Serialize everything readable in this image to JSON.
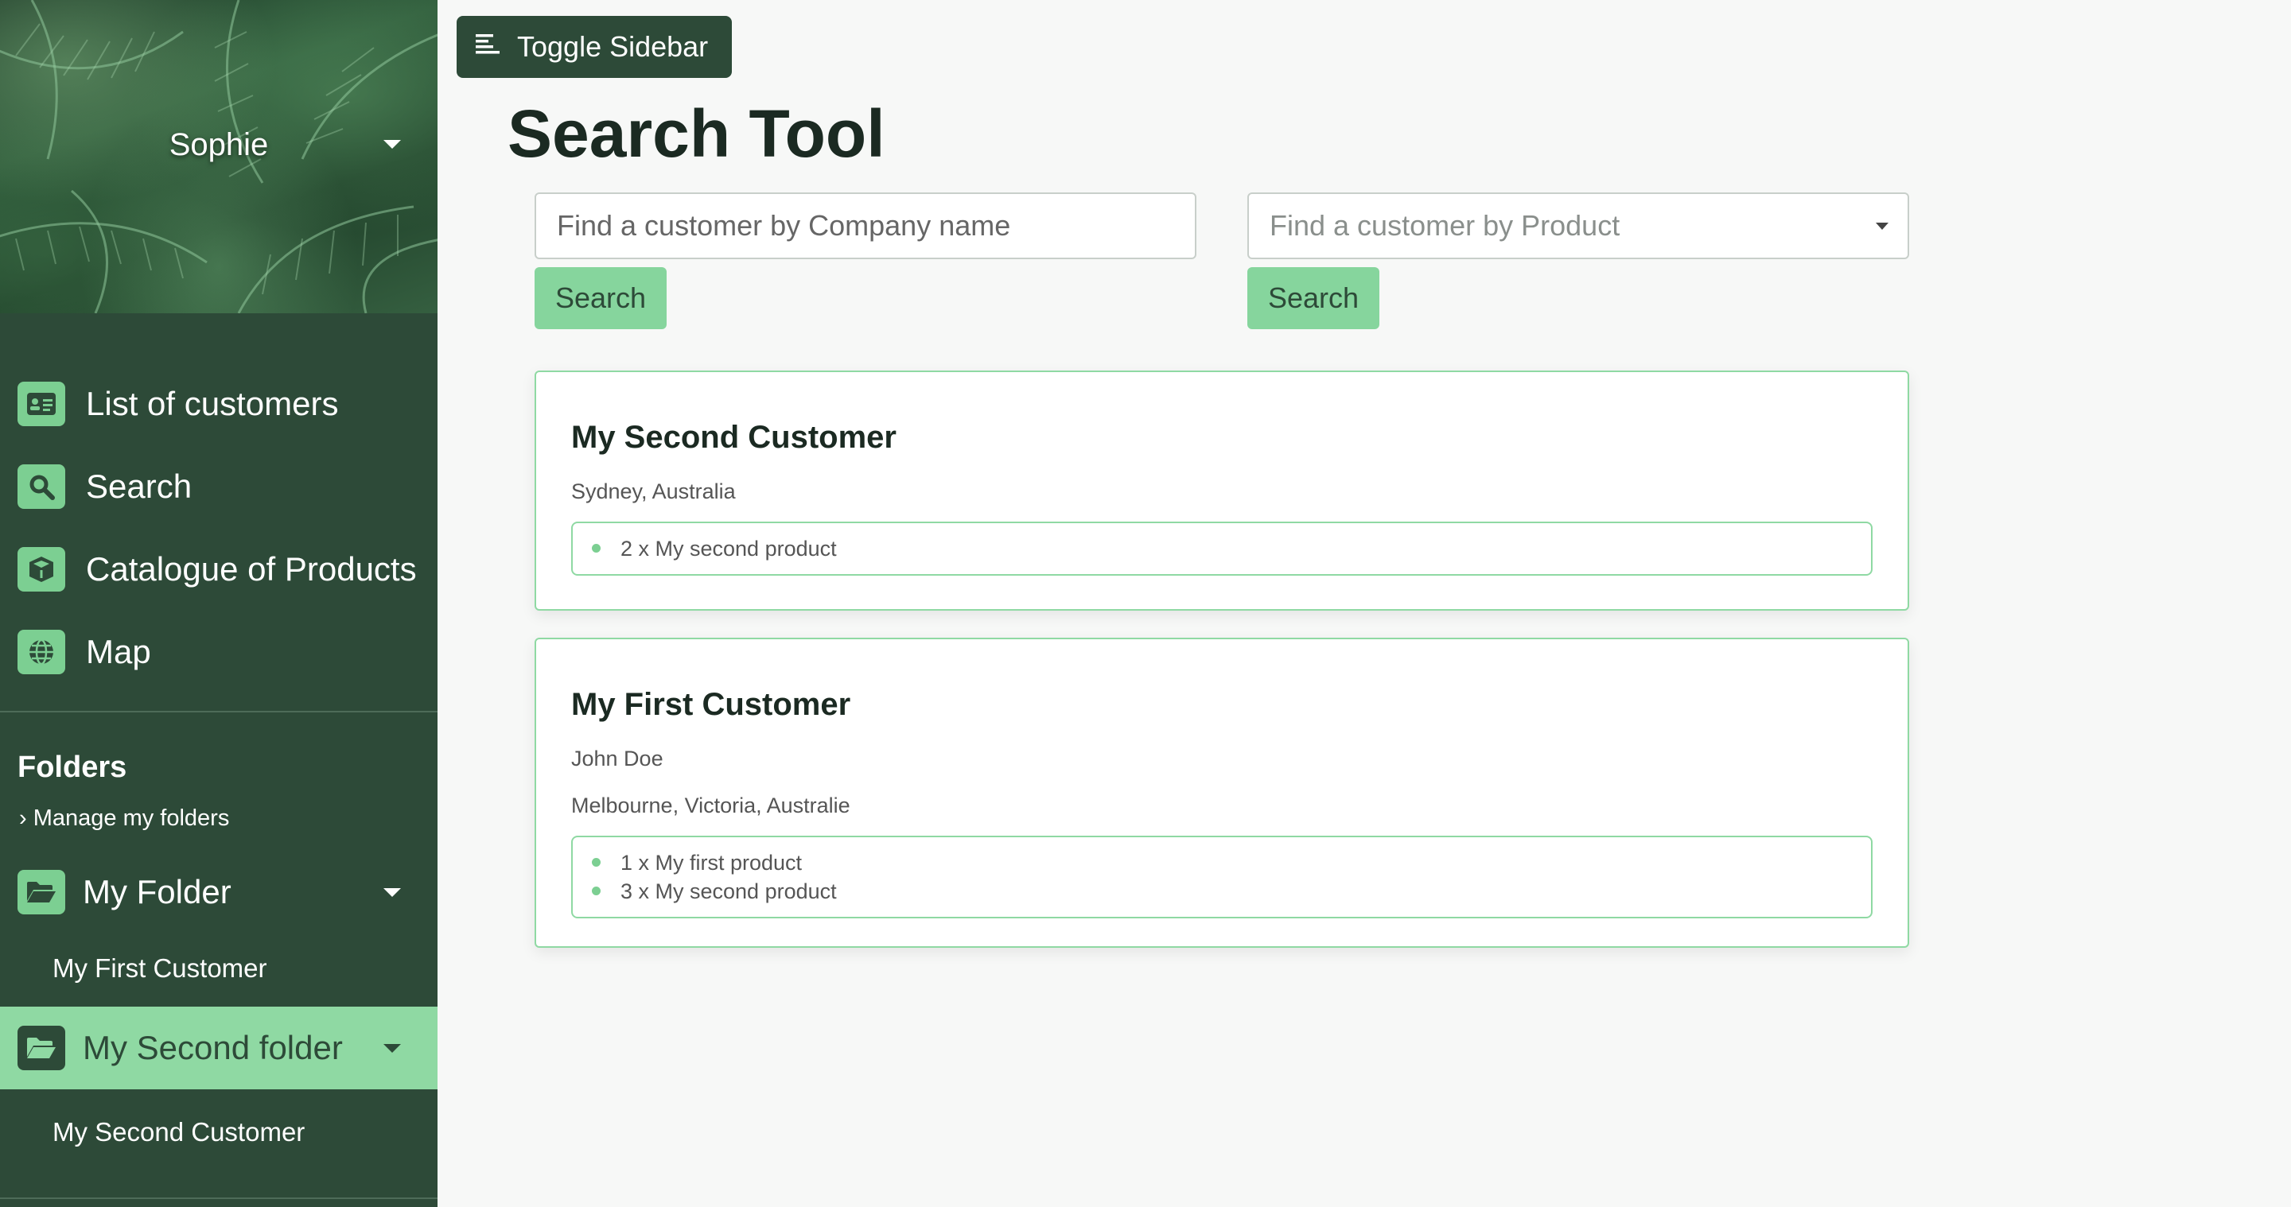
{
  "sidebar": {
    "user_name": "Sophie",
    "nav": [
      {
        "label": "List of customers",
        "icon": "id-card-icon"
      },
      {
        "label": "Search",
        "icon": "search-icon"
      },
      {
        "label": "Catalogue of Products",
        "icon": "box-icon"
      },
      {
        "label": "Map",
        "icon": "globe-icon"
      }
    ],
    "folders_title": "Folders",
    "manage_folders": "› Manage my folders",
    "folders": [
      {
        "label": "My Folder",
        "icon": "folder-open-icon",
        "active": false,
        "children": [
          "My First Customer"
        ]
      },
      {
        "label": "My Second folder",
        "icon": "folder-open-icon",
        "active": true,
        "children": [
          "My Second Customer"
        ]
      }
    ]
  },
  "toolbar": {
    "toggle_label": "Toggle Sidebar",
    "toggle_icon": "align-left-icon"
  },
  "main": {
    "title": "Search Tool",
    "company_search": {
      "placeholder": "Find a customer by Company name",
      "button": "Search"
    },
    "product_search": {
      "placeholder": "Find a customer by Product",
      "button": "Search"
    },
    "results": [
      {
        "name": "My Second Customer",
        "lines": [
          "Sydney, Australia"
        ],
        "products": [
          "2 x My second product"
        ]
      },
      {
        "name": "My First Customer",
        "lines": [
          "John Doe",
          "Melbourne, Victoria, Australie"
        ],
        "products": [
          "1 x My first product",
          "3 x My second product"
        ]
      }
    ]
  },
  "colors": {
    "sidebar_bg": "#2d4a38",
    "accent": "#86d59d",
    "active_folder_bg": "#8fd9a3",
    "card_border": "#8fd9a3"
  }
}
